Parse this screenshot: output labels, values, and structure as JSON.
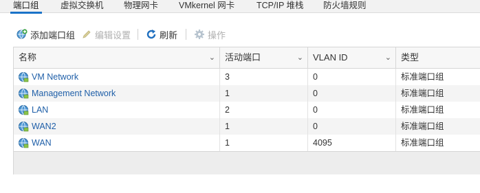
{
  "tabs": [
    {
      "label": "端口组",
      "active": true
    },
    {
      "label": "虚拟交换机",
      "active": false
    },
    {
      "label": "物理网卡",
      "active": false
    },
    {
      "label": "VMkernel 网卡",
      "active": false
    },
    {
      "label": "TCP/IP 堆栈",
      "active": false
    },
    {
      "label": "防火墙规则",
      "active": false
    }
  ],
  "toolbar": {
    "add_label": "添加端口组",
    "edit_label": "编辑设置",
    "refresh_label": "刷新",
    "actions_label": "操作"
  },
  "table": {
    "columns": [
      "名称",
      "活动端口",
      "VLAN ID",
      "类型"
    ],
    "rows": [
      {
        "name": "VM Network",
        "active_ports": "3",
        "vlan_id": "0",
        "type": "标准端口组"
      },
      {
        "name": "Management Network",
        "active_ports": "1",
        "vlan_id": "0",
        "type": "标准端口组"
      },
      {
        "name": "LAN",
        "active_ports": "2",
        "vlan_id": "0",
        "type": "标准端口组"
      },
      {
        "name": "WAN2",
        "active_ports": "1",
        "vlan_id": "0",
        "type": "标准端口组"
      },
      {
        "name": "WAN",
        "active_ports": "1",
        "vlan_id": "4095",
        "type": "标准端口组"
      }
    ]
  },
  "colors": {
    "accent": "#1a73c8",
    "link": "#1f5fa8"
  }
}
